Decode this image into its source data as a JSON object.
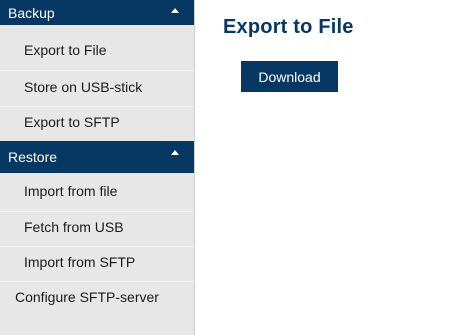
{
  "sidebar": {
    "backup": {
      "title": "Backup",
      "items": [
        {
          "label": "Export to File"
        },
        {
          "label": "Store on USB-stick"
        },
        {
          "label": "Export to SFTP"
        }
      ]
    },
    "restore": {
      "title": "Restore",
      "items": [
        {
          "label": "Import from file"
        },
        {
          "label": "Fetch from USB"
        },
        {
          "label": "Import from SFTP"
        },
        {
          "label": "Configure SFTP-server"
        }
      ]
    }
  },
  "main": {
    "title": "Export to File",
    "download_label": "Download"
  },
  "colors": {
    "accent": "#073763",
    "sidebar_bg": "#e7e7e7"
  },
  "icons": {
    "section_toggle": "caret-up-icon"
  }
}
